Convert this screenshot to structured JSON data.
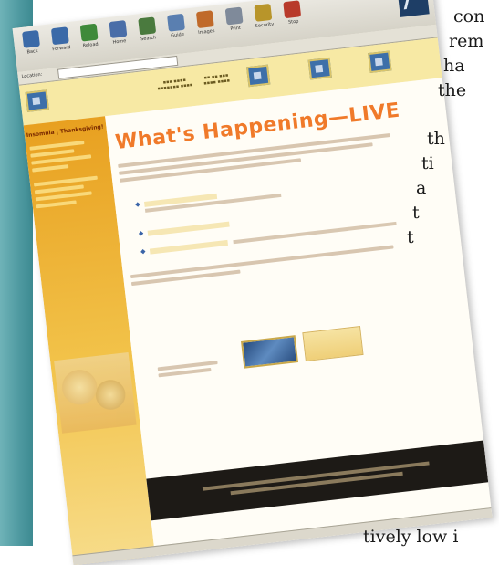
{
  "page_text": {
    "line1": "con",
    "line2": "rem",
    "line3": "ha",
    "line4": "the",
    "line5": "th",
    "line6": "ti",
    "line7": "a",
    "line8": "t",
    "line9": "t",
    "bottom": "tively low i"
  },
  "browser": {
    "toolbar_items": [
      {
        "label": "Back",
        "icon": "back-arrow-icon",
        "color": "#3b6aa8"
      },
      {
        "label": "Forward",
        "icon": "forward-arrow-icon",
        "color": "#3b6aa8"
      },
      {
        "label": "Reload",
        "icon": "reload-icon",
        "color": "#3f8a3a"
      },
      {
        "label": "Home",
        "icon": "home-icon",
        "color": "#4a6ea8"
      },
      {
        "label": "Search",
        "icon": "search-icon",
        "color": "#4a7a3e"
      },
      {
        "label": "Guide",
        "icon": "guide-icon",
        "color": "#5a7fb0"
      },
      {
        "label": "Images",
        "icon": "images-icon",
        "color": "#c06a2a"
      },
      {
        "label": "Print",
        "icon": "print-icon",
        "color": "#7f8a9a"
      },
      {
        "label": "Security",
        "icon": "lock-icon",
        "color": "#b8952a"
      },
      {
        "label": "Stop",
        "icon": "stop-icon",
        "color": "#b83a2a"
      }
    ],
    "location_label": "Location:"
  },
  "site": {
    "headline": "What's Happening—LIVE",
    "sidebar_title": "Insomnia | Thanksgiving!"
  },
  "colors": {
    "accent": "#f07a2a",
    "sidebar": "#efb23a",
    "nav": "#3d6fa9"
  }
}
